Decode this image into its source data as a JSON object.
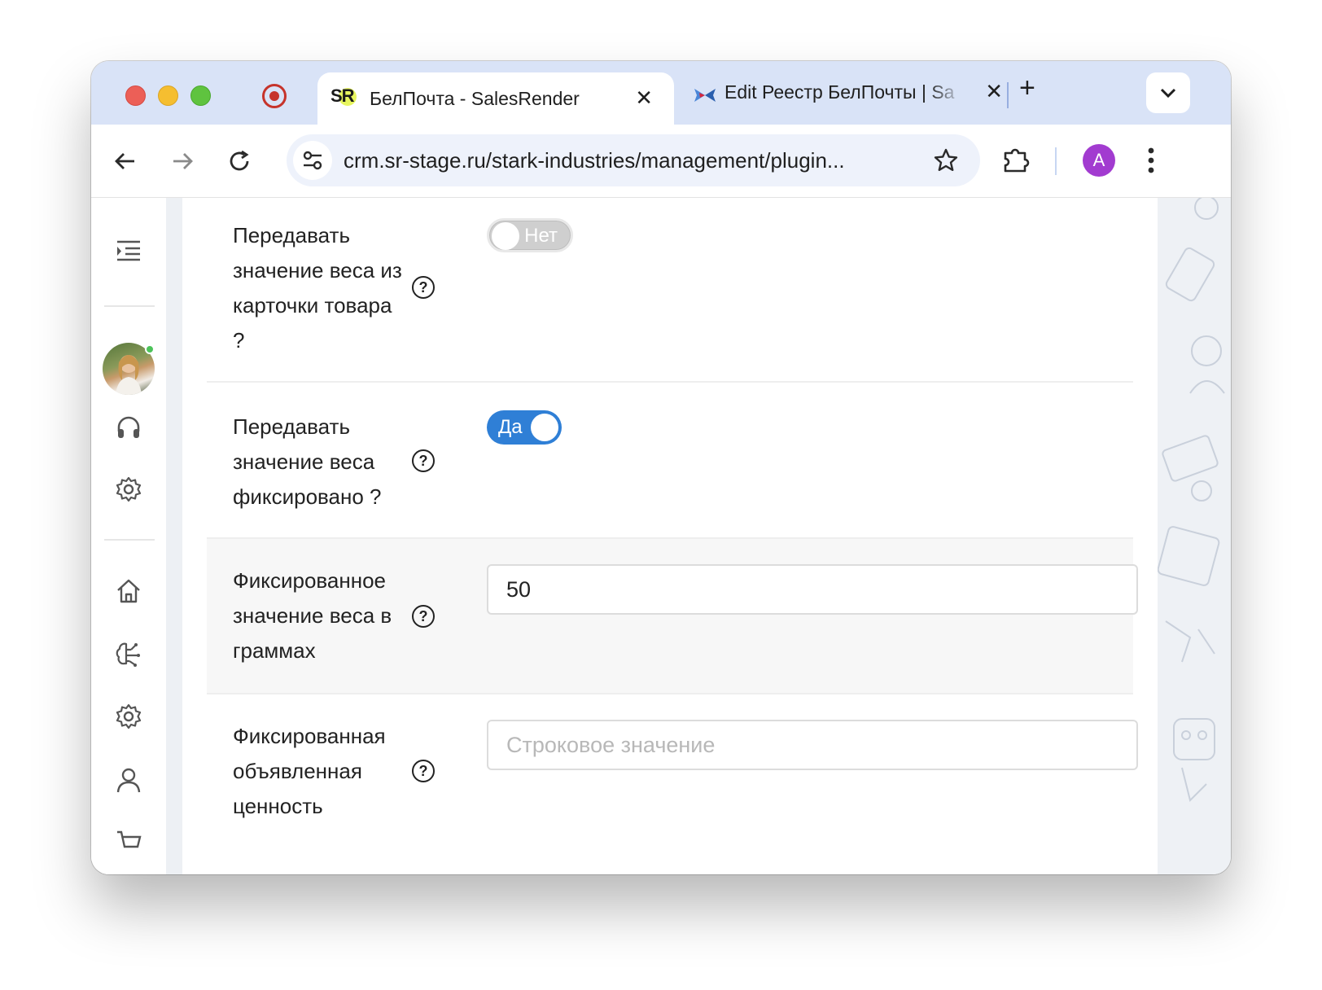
{
  "browser": {
    "tabs": [
      {
        "title": "БелПочта - SalesRender",
        "favicon": "SR",
        "active": true
      },
      {
        "title": "Edit Реестр БелПочты | Sa",
        "active": false
      }
    ],
    "url": "crm.sr-stage.ru/stark-industries/management/plugin...",
    "profile_initial": "A",
    "colors": {
      "tabstrip": "#d9e3f7",
      "profile": "#a23bd0"
    }
  },
  "sidebar": {
    "icons": [
      "menu-expand-icon",
      "headset-icon",
      "gear-icon",
      "home-icon",
      "brain-icon",
      "gear-icon",
      "user-icon",
      "cart-icon"
    ],
    "user_online": true
  },
  "form": {
    "fields": [
      {
        "label": "Передавать значение веса из карточки товара ?",
        "control": "toggle",
        "value": "Нет",
        "checked": false
      },
      {
        "label": "Передавать значение веса фиксировано ?",
        "control": "toggle",
        "value": "Да",
        "checked": true
      },
      {
        "label": "Фиксированное значение веса в граммах",
        "control": "input",
        "value": "50",
        "placeholder": ""
      },
      {
        "label": "Фиксированная объявленная ценность",
        "control": "input",
        "value": "",
        "placeholder": "Строковое значение"
      }
    ],
    "colors": {
      "toggle_on": "#2f7fd6",
      "toggle_off": "#cfcfcf",
      "shaded_row": "#f7f7f7"
    }
  }
}
